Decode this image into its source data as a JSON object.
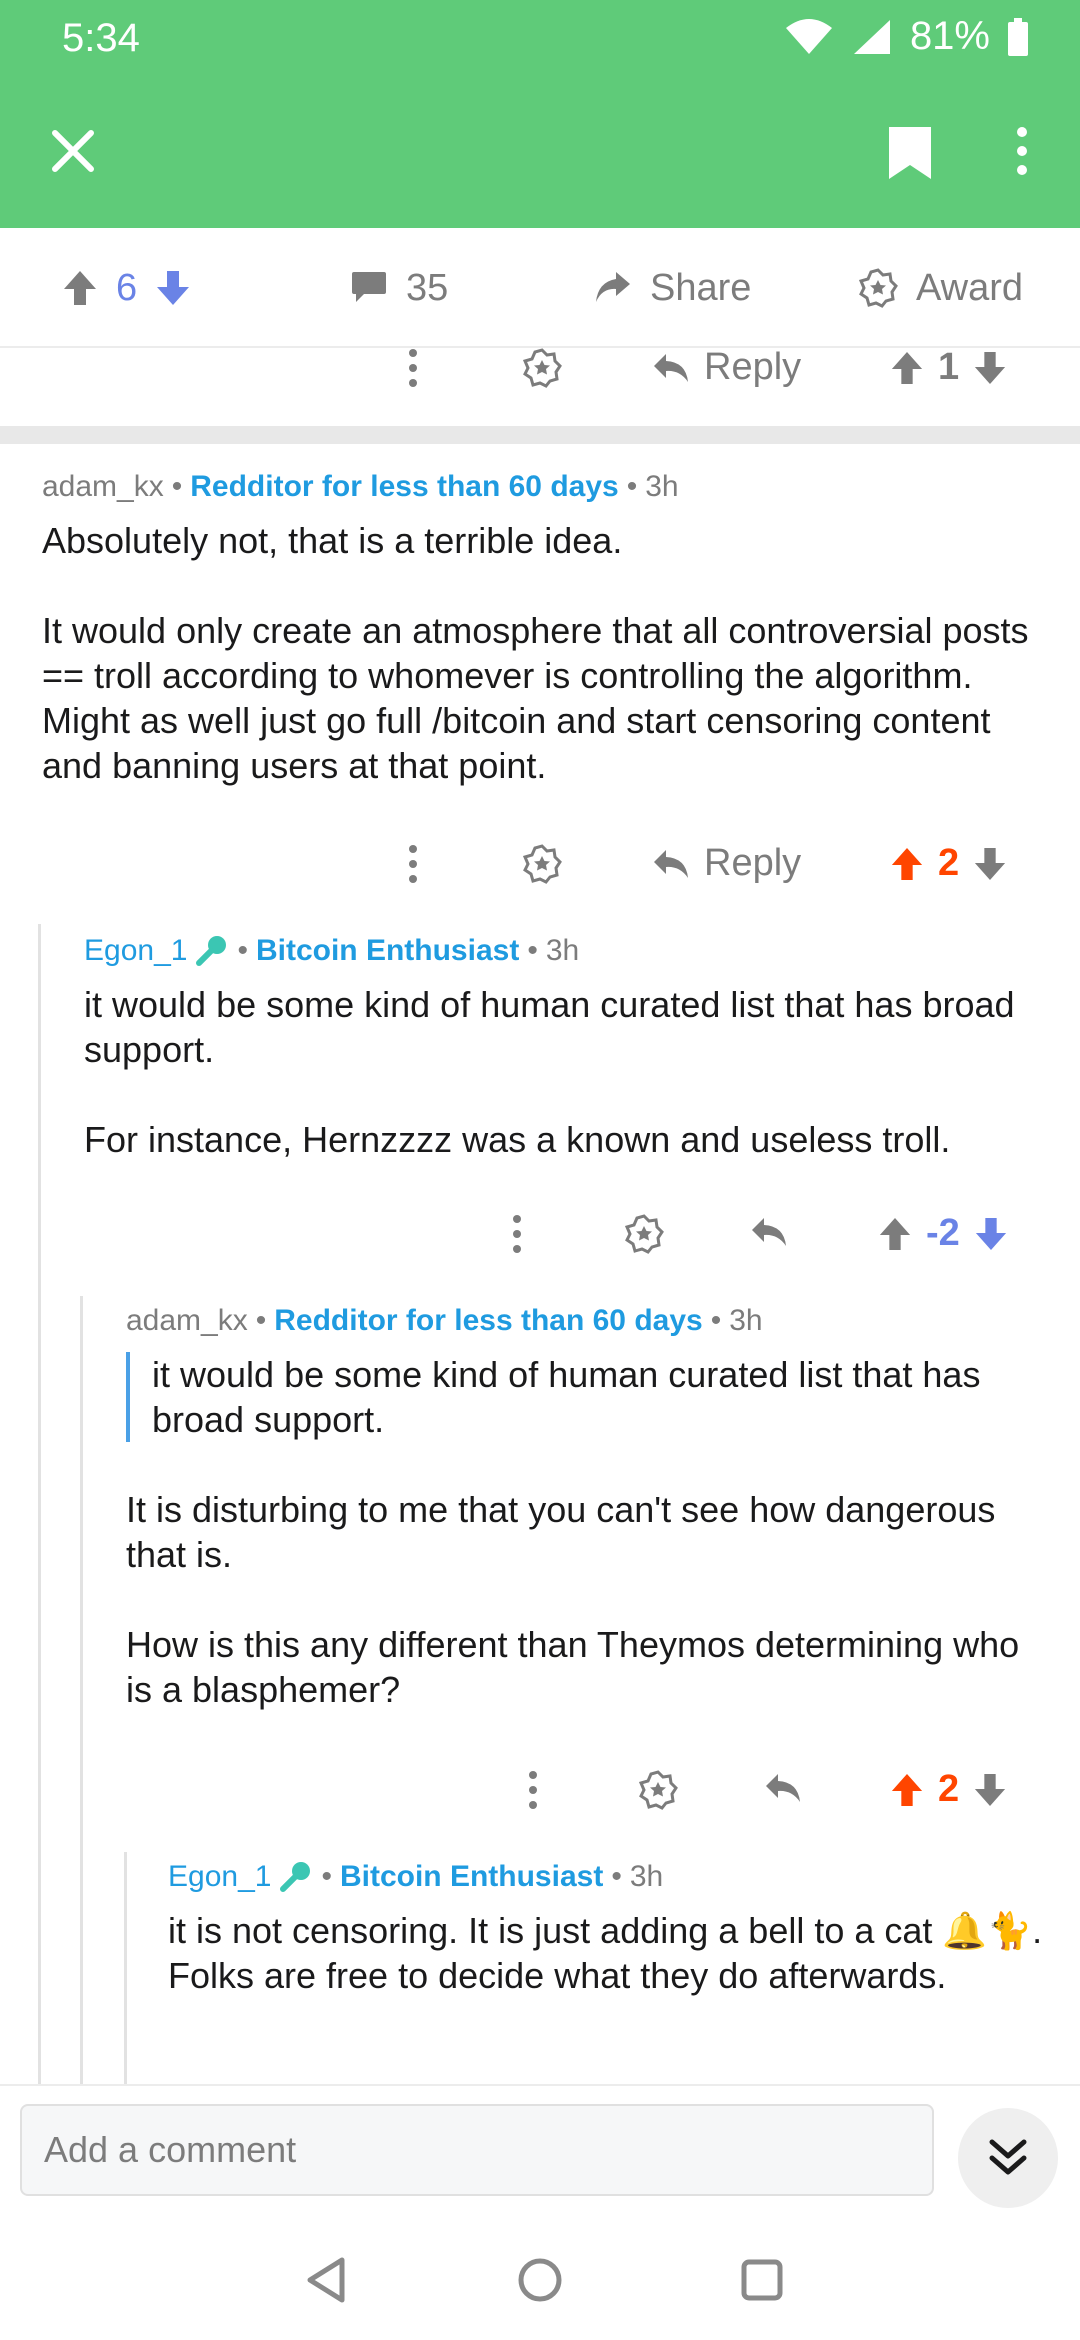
{
  "status_bar": {
    "time": "5:34",
    "battery": "81%"
  },
  "app_bar": {
    "close_icon": "close-icon",
    "bookmark_icon": "bookmark-icon",
    "more_icon": "more-vertical-icon"
  },
  "post_actions": {
    "score": "6",
    "comments": "35",
    "share": "Share",
    "award": "Award"
  },
  "partial_row": {
    "reply": "Reply",
    "score": "1"
  },
  "comments": [
    {
      "author": "adam_kx",
      "flair": "Redditor for less than 60 days",
      "time": "3h",
      "paragraphs": [
        "Absolutely not, that is a terrible idea.",
        "It would only create an atmosphere that all controversial posts == troll according to whomever is controlling the algorithm. Might as well just go full /bitcoin and start censoring content and banning users at that point."
      ],
      "reply": "Reply",
      "score": "2"
    },
    {
      "author": "Egon_1",
      "flair": "Bitcoin Enthusiast",
      "time": "3h",
      "paragraphs": [
        "it would be some kind of human curated list that has broad support.",
        "For instance, Hernzzzz was a known and useless troll."
      ],
      "score": "-2"
    },
    {
      "author": "adam_kx",
      "flair": "Redditor for less than 60 days",
      "time": "3h",
      "quote": "it would be some kind of human curated list that has broad support.",
      "paragraphs": [
        "It is disturbing to me that you can't see how dangerous that is.",
        "How is this any different than Theymos determining who is a blasphemer?"
      ],
      "score": "2"
    },
    {
      "author": "Egon_1",
      "flair": "Bitcoin Enthusiast",
      "time": "3h",
      "paragraphs": [
        "it is not censoring. It is just adding a bell to a cat 🔔🐈. Folks are free to decide what they do afterwards."
      ]
    }
  ],
  "comment_bar": {
    "placeholder": "Add a comment"
  },
  "colors": {
    "app_green": "#5fcb79",
    "upvoted": "#ff4500",
    "downvoted": "#6a83e6",
    "flair": "#1f9be0"
  }
}
